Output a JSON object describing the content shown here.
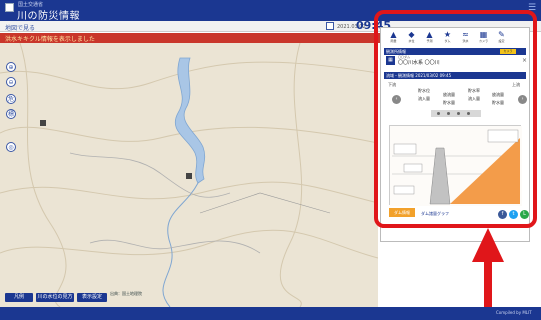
{
  "header": {
    "ministry": "国土交通省",
    "title": "川の防災情報",
    "search_label": "地図で見る",
    "date": "2021.03.02",
    "time": "09:45"
  },
  "alert": {
    "text": "洪水キキクル情報を表示しました"
  },
  "map": {
    "controls": [
      "⊕",
      "⊖",
      "危",
      "標",
      "◎"
    ],
    "buttons": [
      "凡例",
      "川の水位の見方",
      "表示設定"
    ],
    "attribution": "出典：国土地理院"
  },
  "panel": {
    "tabs": [
      {
        "icon": "▲",
        "label": "雨量"
      },
      {
        "icon": "◆",
        "label": "水位"
      },
      {
        "icon": "▲",
        "label": "予測"
      },
      {
        "icon": "★",
        "label": "ダム"
      },
      {
        "icon": "≈",
        "label": "洪水"
      },
      {
        "icon": "▦",
        "label": "カメラ"
      },
      {
        "icon": "✎",
        "label": "設定"
      }
    ],
    "section1": "観測所情報",
    "camera_badge": "カメラ",
    "location_sub": "〇〇ダム",
    "location_name": "〇〇川水系 〇〇川",
    "section2": "流域・観測情報 2021/03/02 09:45",
    "left_label": "下流",
    "right_label": "上流",
    "stats_left": [
      "貯水位",
      "流入量",
      "放流量",
      "貯水量"
    ],
    "stats_right": [
      "貯水率",
      "流入量",
      "放流量",
      "貯水量"
    ],
    "dam_button": "ダム情報",
    "link_text": "ダム諸量グラフ"
  },
  "footer": {
    "text": "Compiled by MLIT"
  },
  "colors": {
    "header": "#1b3791",
    "alert": "#c9362b",
    "highlight": "#e0161a",
    "accent": "#f2a12b"
  }
}
